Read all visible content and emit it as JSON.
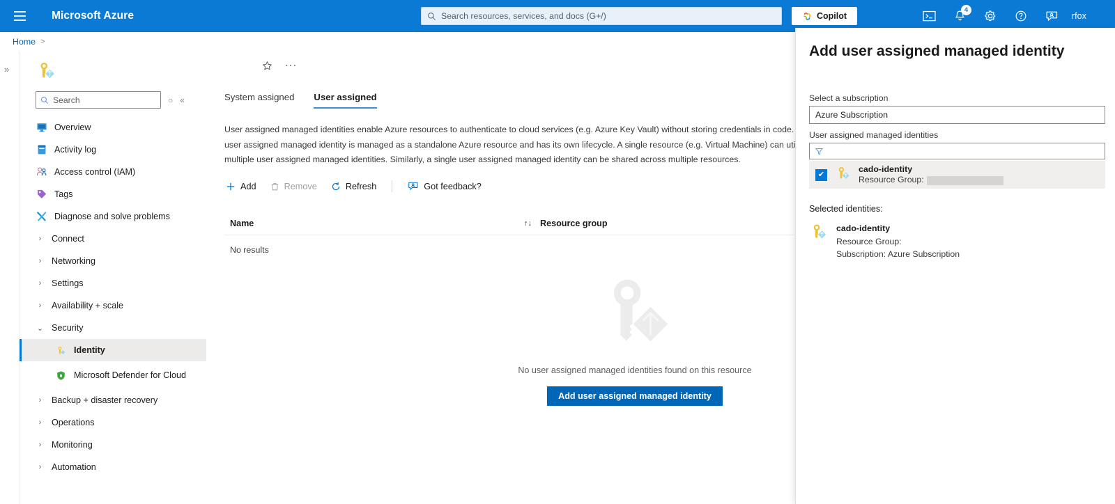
{
  "topbar": {
    "menu_icon": "hamburger-icon",
    "brand": "Microsoft Azure",
    "search_placeholder": "Search resources, services, and docs (G+/)",
    "search_icon": "search-icon",
    "copilot_label": "Copilot",
    "copilot_icon": "copilot-icon",
    "icons": [
      {
        "name": "cloud-shell-icon",
        "label": "Cloud Shell"
      },
      {
        "name": "notifications-bell-icon",
        "label": "Notifications",
        "badge": "4"
      },
      {
        "name": "settings-gear-icon",
        "label": "Settings"
      },
      {
        "name": "help-question-icon",
        "label": "Help"
      },
      {
        "name": "feedback-icon",
        "label": "Feedback"
      }
    ],
    "username": "rfox"
  },
  "breadcrumb": {
    "home": "Home",
    "separator": ">"
  },
  "rail": {
    "expand_glyph": "»"
  },
  "sidebar": {
    "resource_icon": "managed-identity-key-icon",
    "search_placeholder": "Search",
    "search_icon": "search-icon",
    "refresh_glyph": "○",
    "collapse_glyph": "«",
    "items": [
      {
        "label": "Overview",
        "icon": "overview-monitor-icon",
        "type": "leaf"
      },
      {
        "label": "Activity log",
        "icon": "activity-log-icon",
        "type": "leaf"
      },
      {
        "label": "Access control (IAM)",
        "icon": "access-control-users-icon",
        "type": "leaf"
      },
      {
        "label": "Tags",
        "icon": "tags-icon",
        "type": "leaf"
      },
      {
        "label": "Diagnose and solve problems",
        "icon": "diagnose-tools-icon",
        "type": "leaf"
      },
      {
        "label": "Connect",
        "icon": "chevron-right-icon",
        "type": "group"
      },
      {
        "label": "Networking",
        "icon": "chevron-right-icon",
        "type": "group"
      },
      {
        "label": "Settings",
        "icon": "chevron-right-icon",
        "type": "group"
      },
      {
        "label": "Availability + scale",
        "icon": "chevron-right-icon",
        "type": "group"
      },
      {
        "label": "Security",
        "icon": "chevron-down-icon",
        "type": "group-expanded"
      },
      {
        "label": "Identity",
        "icon": "managed-identity-key-icon",
        "type": "child",
        "selected": true
      },
      {
        "label": "Microsoft Defender for Cloud",
        "icon": "defender-shield-icon",
        "type": "child"
      },
      {
        "label": "Backup + disaster recovery",
        "icon": "chevron-right-icon",
        "type": "group"
      },
      {
        "label": "Operations",
        "icon": "chevron-right-icon",
        "type": "group"
      },
      {
        "label": "Monitoring",
        "icon": "chevron-right-icon",
        "type": "group"
      },
      {
        "label": "Automation",
        "icon": "chevron-right-icon",
        "type": "group"
      }
    ]
  },
  "main": {
    "favorite_icon": "star-icon",
    "more_icon": "ellipsis-icon",
    "tabs": [
      {
        "label": "System assigned",
        "active": false
      },
      {
        "label": "User assigned",
        "active": true
      }
    ],
    "description": "User assigned managed identities enable Azure resources to authenticate to cloud services (e.g. Azure Key Vault) without storing credentials in code. A user assigned managed identity is managed as a standalone Azure resource and has its own lifecycle. A single resource (e.g. Virtual Machine) can utilize multiple user assigned managed identities. Similarly, a single user assigned managed identity can be shared across multiple resources.",
    "commands": [
      {
        "label": "Add",
        "icon": "plus-icon",
        "disabled": false
      },
      {
        "label": "Remove",
        "icon": "trash-icon",
        "disabled": true
      },
      {
        "label": "Refresh",
        "icon": "refresh-icon",
        "disabled": false
      },
      {
        "label": "Got feedback?",
        "icon": "feedback-icon",
        "disabled": false
      }
    ],
    "table": {
      "columns": [
        "Name",
        "Resource group"
      ],
      "sort_glyph": "↑↓",
      "no_results": "No results"
    },
    "empty_state": {
      "watermark_icon": "managed-identity-key-watermark",
      "message": "No user assigned managed identities found on this resource",
      "button_label": "Add user assigned managed identity"
    }
  },
  "blade": {
    "title": "Add user assigned managed identity",
    "subscription_label": "Select a subscription",
    "subscription_value": "Azure Subscription",
    "identities_label": "User assigned managed identities",
    "filter_icon": "filter-funnel-icon",
    "filter_value": "",
    "identity_rows": [
      {
        "name": "cado-identity",
        "resource_group_label": "Resource Group:",
        "resource_group_value": "",
        "checked": true,
        "icon": "managed-identity-key-icon",
        "check_glyph": "✔"
      }
    ],
    "selected_title": "Selected identities:",
    "selected": [
      {
        "name": "cado-identity",
        "resource_group_line": "Resource Group:",
        "subscription_line": "Subscription: Azure Subscription",
        "icon": "managed-identity-key-icon"
      }
    ]
  },
  "colors": {
    "azure_blue": "#0B7AD4",
    "accent": "#0078D4",
    "primary_button": "#0067B8",
    "selected_row": "#EDEBE9",
    "link": "#0066B4"
  }
}
